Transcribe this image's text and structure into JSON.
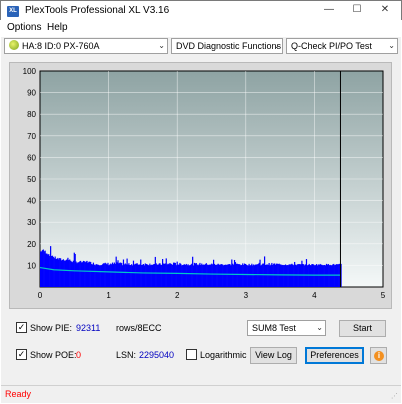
{
  "window": {
    "title": "PlexTools Professional XL V3.16",
    "icon_text": "XL",
    "minimize_glyph": "—",
    "maximize_glyph": "☐",
    "close_glyph": "✕"
  },
  "menu": {
    "items": [
      "Options",
      "Help"
    ]
  },
  "toolbar": {
    "drive": "HA:8 ID:0  PX-760A",
    "function": "DVD Diagnostic Functions",
    "test": "Q-Check PI/PO Test",
    "dropdown_glyph": "⌄",
    "drive_icon": "disc-drive-icon"
  },
  "chart_data": {
    "type": "area",
    "xlim": [
      0,
      5
    ],
    "ylim": [
      0,
      100
    ],
    "x_ticks": [
      0,
      1,
      2,
      3,
      4,
      5
    ],
    "y_ticks": [
      10,
      20,
      30,
      40,
      50,
      60,
      70,
      80,
      90,
      100
    ],
    "grid": true,
    "end_marker_x": 4.38,
    "series": [
      {
        "role": "PIE bars",
        "color": "#0000ff",
        "x": [
          0.0,
          0.1,
          0.2,
          0.3,
          0.4,
          0.5,
          0.6,
          0.7,
          0.8,
          0.9,
          1.0,
          1.1,
          1.2,
          1.3,
          1.4,
          1.5,
          1.6,
          1.7,
          1.8,
          1.9,
          2.0,
          2.1,
          2.2,
          2.3,
          2.4,
          2.5,
          2.6,
          2.7,
          2.8,
          2.9,
          3.0,
          3.1,
          3.2,
          3.3,
          3.4,
          3.5,
          3.6,
          3.7,
          3.8,
          3.9,
          4.0,
          4.1,
          4.2,
          4.3,
          4.38
        ],
        "y": [
          17,
          15,
          13,
          12,
          12,
          11,
          11,
          11,
          10,
          10,
          10,
          10,
          10,
          10,
          10,
          10,
          10,
          10,
          10,
          10,
          10,
          10,
          10,
          10,
          10,
          10,
          10,
          10,
          10,
          10,
          10,
          10,
          10,
          10,
          10,
          10,
          10,
          10,
          10,
          10,
          10,
          10,
          10,
          10,
          10
        ]
      },
      {
        "role": "PIE peaks",
        "color": "#0000ff",
        "x": [
          0.02,
          0.06,
          0.1,
          0.2,
          0.35,
          0.5,
          0.7,
          0.9,
          1.1,
          1.3,
          1.5,
          1.7,
          1.9,
          2.1,
          2.3,
          2.5,
          2.7,
          2.9,
          3.1,
          3.3,
          3.5,
          3.7,
          3.9,
          4.1,
          4.3
        ],
        "y": [
          21,
          22,
          20,
          18,
          17,
          16,
          15,
          15,
          16,
          14,
          15,
          14,
          16,
          14,
          15,
          14,
          13,
          14,
          13,
          15,
          14,
          13,
          13,
          13,
          13
        ]
      },
      {
        "role": "PIE average",
        "color": "#00c8c8",
        "x": [
          0.0,
          0.2,
          0.5,
          1.0,
          1.5,
          2.0,
          2.5,
          3.0,
          3.5,
          4.0,
          4.38
        ],
        "y": [
          9,
          8,
          7.5,
          7,
          6.5,
          6.3,
          6,
          5.8,
          5.6,
          5.5,
          5.5
        ]
      }
    ]
  },
  "controls": {
    "show_pie_label": "Show PIE:",
    "show_pie_value": "92311",
    "rows_label": "rows/8ECC",
    "show_poe_label": "Show POE:",
    "show_poe_value": "0",
    "lsn_label": "LSN:",
    "lsn_value": "2295040",
    "logarithmic_label": "Logarithmic",
    "sum_select": "SUM8 Test",
    "start_label": "Start",
    "view_log_label": "View Log",
    "preferences_label": "Preferences",
    "check_glyph": "✓",
    "info_glyph": "i",
    "colors": {
      "pie_value": "#0000c0",
      "poe_value": "#ff0000",
      "lsn_value": "#0000c0"
    }
  },
  "status": {
    "text": "Ready",
    "color": "#ff0000",
    "grip_glyph": "⋰"
  }
}
